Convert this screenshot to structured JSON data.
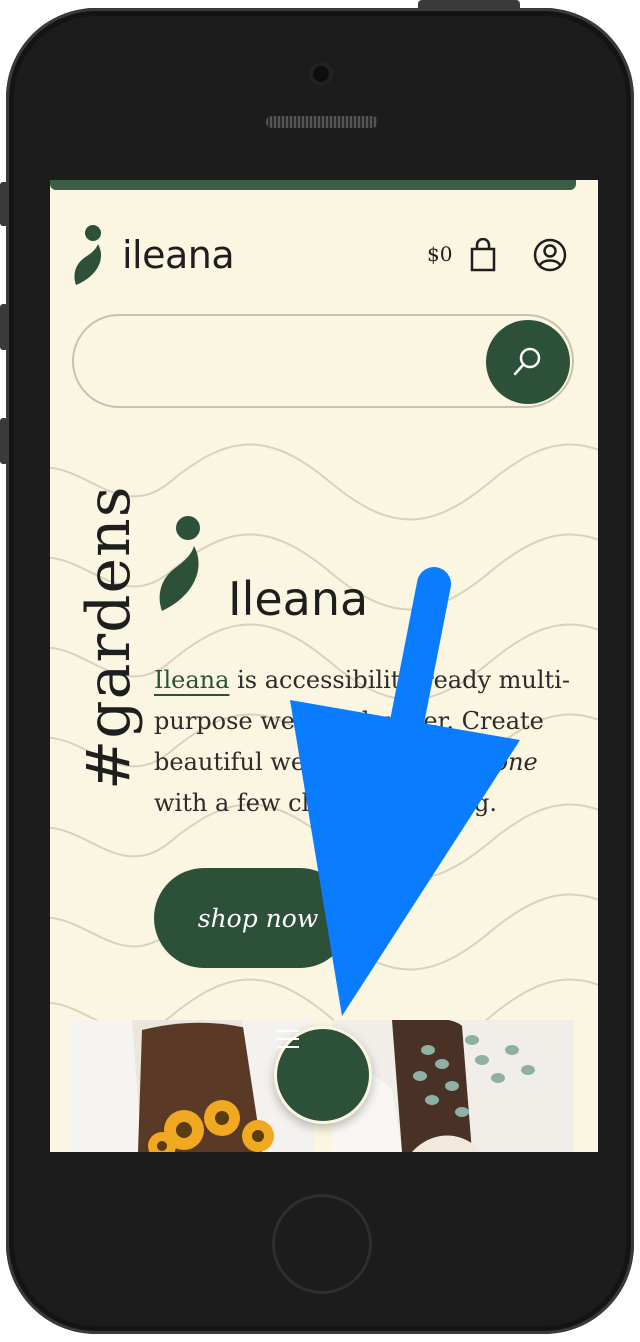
{
  "header": {
    "brand": "ileana",
    "cart_total": "$0",
    "icons": [
      "logo-icon",
      "shopping-bag-icon",
      "user-account-icon"
    ]
  },
  "search": {
    "placeholder": "",
    "button_icon": "search-icon"
  },
  "hero": {
    "vertical_tag": "#gardens",
    "title": "Ileana",
    "link_text": "Ileana",
    "text_1": " is accessibility-ready multi-purpose website builder. Create beautiful websites for ",
    "text_emph": "everyone",
    "text_2": " with a few clicks of nothing.",
    "cta_label": "shop now"
  },
  "bottom": {
    "menu_icon": "hamburger-menu-icon"
  },
  "colors": {
    "accent": "#2c5038",
    "background": "#fbf6e1",
    "annotation_arrow": "#0a7cff"
  }
}
